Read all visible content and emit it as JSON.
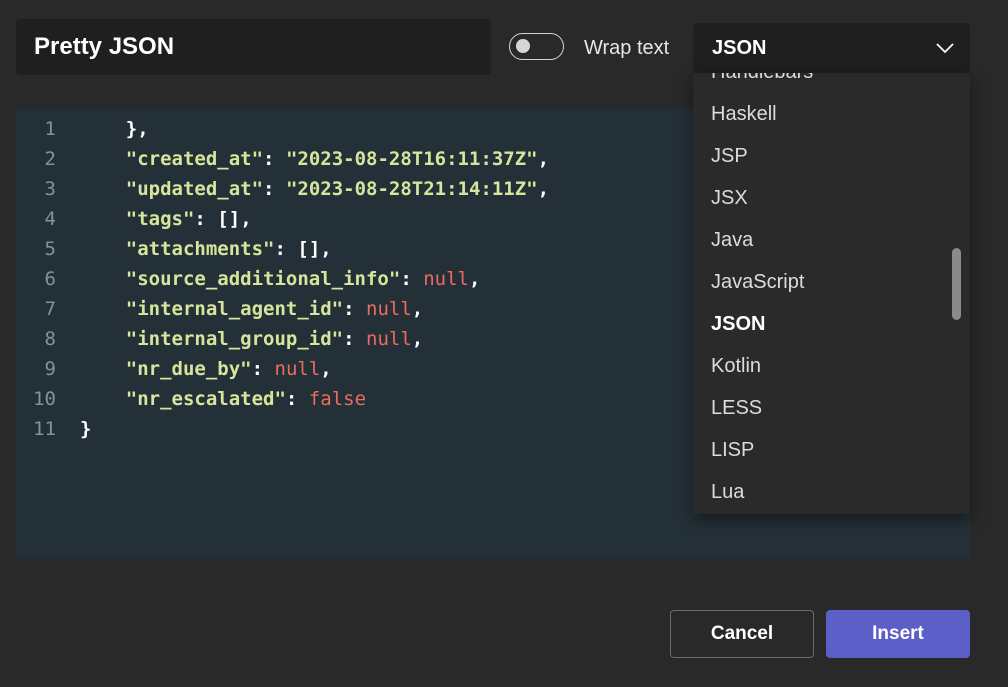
{
  "header": {
    "title": "Pretty JSON",
    "wrap_text_label": "Wrap text",
    "wrap_text_enabled": false
  },
  "language_select": {
    "selected": "JSON",
    "options": [
      "Handlebars",
      "Haskell",
      "JSP",
      "JSX",
      "Java",
      "JavaScript",
      "JSON",
      "Kotlin",
      "LESS",
      "LISP",
      "Lua"
    ]
  },
  "editor": {
    "lines": [
      {
        "n": "1",
        "indent": "    ",
        "key": "",
        "sep": "",
        "value": "",
        "vtype": "",
        "tail": "},"
      },
      {
        "n": "2",
        "indent": "    ",
        "key": "\"created_at\"",
        "sep": ": ",
        "value": "\"2023-08-28T16:11:37Z\"",
        "vtype": "str",
        "tail": ","
      },
      {
        "n": "3",
        "indent": "    ",
        "key": "\"updated_at\"",
        "sep": ": ",
        "value": "\"2023-08-28T21:14:11Z\"",
        "vtype": "str",
        "tail": ","
      },
      {
        "n": "4",
        "indent": "    ",
        "key": "\"tags\"",
        "sep": ": ",
        "value": "[]",
        "vtype": "punct",
        "tail": ","
      },
      {
        "n": "5",
        "indent": "    ",
        "key": "\"attachments\"",
        "sep": ": ",
        "value": "[]",
        "vtype": "punct",
        "tail": ","
      },
      {
        "n": "6",
        "indent": "    ",
        "key": "\"source_additional_info\"",
        "sep": ": ",
        "value": "null",
        "vtype": "kw",
        "tail": ","
      },
      {
        "n": "7",
        "indent": "    ",
        "key": "\"internal_agent_id\"",
        "sep": ": ",
        "value": "null",
        "vtype": "kw",
        "tail": ","
      },
      {
        "n": "8",
        "indent": "    ",
        "key": "\"internal_group_id\"",
        "sep": ": ",
        "value": "null",
        "vtype": "kw",
        "tail": ","
      },
      {
        "n": "9",
        "indent": "    ",
        "key": "\"nr_due_by\"",
        "sep": ": ",
        "value": "null",
        "vtype": "kw",
        "tail": ","
      },
      {
        "n": "10",
        "indent": "    ",
        "key": "\"nr_escalated\"",
        "sep": ": ",
        "value": "false",
        "vtype": "kw",
        "tail": ""
      },
      {
        "n": "11",
        "indent": "",
        "key": "",
        "sep": "",
        "value": "",
        "vtype": "",
        "tail": "}"
      }
    ]
  },
  "footer": {
    "cancel_label": "Cancel",
    "insert_label": "Insert"
  },
  "colors": {
    "background": "#292929",
    "editor_bg": "#243038",
    "key": "#d6e49c",
    "keyword": "#ec6b5f",
    "line_number": "#7e959c",
    "accent": "#5b5fc7"
  }
}
